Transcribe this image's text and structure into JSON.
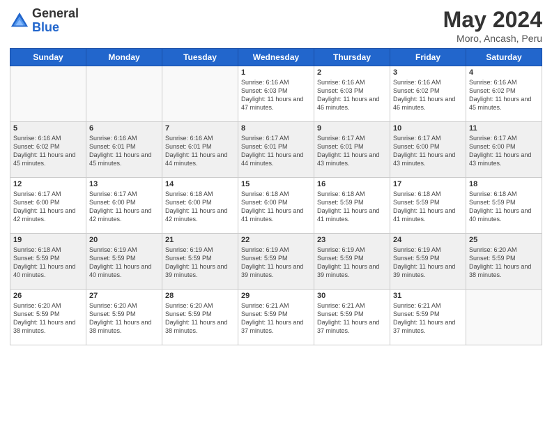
{
  "logo": {
    "general": "General",
    "blue": "Blue"
  },
  "title": "May 2024",
  "location": "Moro, Ancash, Peru",
  "days_of_week": [
    "Sunday",
    "Monday",
    "Tuesday",
    "Wednesday",
    "Thursday",
    "Friday",
    "Saturday"
  ],
  "weeks": [
    [
      {
        "day": "",
        "info": ""
      },
      {
        "day": "",
        "info": ""
      },
      {
        "day": "",
        "info": ""
      },
      {
        "day": "1",
        "info": "Sunrise: 6:16 AM\nSunset: 6:03 PM\nDaylight: 11 hours and 47 minutes."
      },
      {
        "day": "2",
        "info": "Sunrise: 6:16 AM\nSunset: 6:03 PM\nDaylight: 11 hours and 46 minutes."
      },
      {
        "day": "3",
        "info": "Sunrise: 6:16 AM\nSunset: 6:02 PM\nDaylight: 11 hours and 46 minutes."
      },
      {
        "day": "4",
        "info": "Sunrise: 6:16 AM\nSunset: 6:02 PM\nDaylight: 11 hours and 45 minutes."
      }
    ],
    [
      {
        "day": "5",
        "info": "Sunrise: 6:16 AM\nSunset: 6:02 PM\nDaylight: 11 hours and 45 minutes."
      },
      {
        "day": "6",
        "info": "Sunrise: 6:16 AM\nSunset: 6:01 PM\nDaylight: 11 hours and 45 minutes."
      },
      {
        "day": "7",
        "info": "Sunrise: 6:16 AM\nSunset: 6:01 PM\nDaylight: 11 hours and 44 minutes."
      },
      {
        "day": "8",
        "info": "Sunrise: 6:17 AM\nSunset: 6:01 PM\nDaylight: 11 hours and 44 minutes."
      },
      {
        "day": "9",
        "info": "Sunrise: 6:17 AM\nSunset: 6:01 PM\nDaylight: 11 hours and 43 minutes."
      },
      {
        "day": "10",
        "info": "Sunrise: 6:17 AM\nSunset: 6:00 PM\nDaylight: 11 hours and 43 minutes."
      },
      {
        "day": "11",
        "info": "Sunrise: 6:17 AM\nSunset: 6:00 PM\nDaylight: 11 hours and 43 minutes."
      }
    ],
    [
      {
        "day": "12",
        "info": "Sunrise: 6:17 AM\nSunset: 6:00 PM\nDaylight: 11 hours and 42 minutes."
      },
      {
        "day": "13",
        "info": "Sunrise: 6:17 AM\nSunset: 6:00 PM\nDaylight: 11 hours and 42 minutes."
      },
      {
        "day": "14",
        "info": "Sunrise: 6:18 AM\nSunset: 6:00 PM\nDaylight: 11 hours and 42 minutes."
      },
      {
        "day": "15",
        "info": "Sunrise: 6:18 AM\nSunset: 6:00 PM\nDaylight: 11 hours and 41 minutes."
      },
      {
        "day": "16",
        "info": "Sunrise: 6:18 AM\nSunset: 5:59 PM\nDaylight: 11 hours and 41 minutes."
      },
      {
        "day": "17",
        "info": "Sunrise: 6:18 AM\nSunset: 5:59 PM\nDaylight: 11 hours and 41 minutes."
      },
      {
        "day": "18",
        "info": "Sunrise: 6:18 AM\nSunset: 5:59 PM\nDaylight: 11 hours and 40 minutes."
      }
    ],
    [
      {
        "day": "19",
        "info": "Sunrise: 6:18 AM\nSunset: 5:59 PM\nDaylight: 11 hours and 40 minutes."
      },
      {
        "day": "20",
        "info": "Sunrise: 6:19 AM\nSunset: 5:59 PM\nDaylight: 11 hours and 40 minutes."
      },
      {
        "day": "21",
        "info": "Sunrise: 6:19 AM\nSunset: 5:59 PM\nDaylight: 11 hours and 39 minutes."
      },
      {
        "day": "22",
        "info": "Sunrise: 6:19 AM\nSunset: 5:59 PM\nDaylight: 11 hours and 39 minutes."
      },
      {
        "day": "23",
        "info": "Sunrise: 6:19 AM\nSunset: 5:59 PM\nDaylight: 11 hours and 39 minutes."
      },
      {
        "day": "24",
        "info": "Sunrise: 6:19 AM\nSunset: 5:59 PM\nDaylight: 11 hours and 39 minutes."
      },
      {
        "day": "25",
        "info": "Sunrise: 6:20 AM\nSunset: 5:59 PM\nDaylight: 11 hours and 38 minutes."
      }
    ],
    [
      {
        "day": "26",
        "info": "Sunrise: 6:20 AM\nSunset: 5:59 PM\nDaylight: 11 hours and 38 minutes."
      },
      {
        "day": "27",
        "info": "Sunrise: 6:20 AM\nSunset: 5:59 PM\nDaylight: 11 hours and 38 minutes."
      },
      {
        "day": "28",
        "info": "Sunrise: 6:20 AM\nSunset: 5:59 PM\nDaylight: 11 hours and 38 minutes."
      },
      {
        "day": "29",
        "info": "Sunrise: 6:21 AM\nSunset: 5:59 PM\nDaylight: 11 hours and 37 minutes."
      },
      {
        "day": "30",
        "info": "Sunrise: 6:21 AM\nSunset: 5:59 PM\nDaylight: 11 hours and 37 minutes."
      },
      {
        "day": "31",
        "info": "Sunrise: 6:21 AM\nSunset: 5:59 PM\nDaylight: 11 hours and 37 minutes."
      },
      {
        "day": "",
        "info": ""
      }
    ]
  ]
}
